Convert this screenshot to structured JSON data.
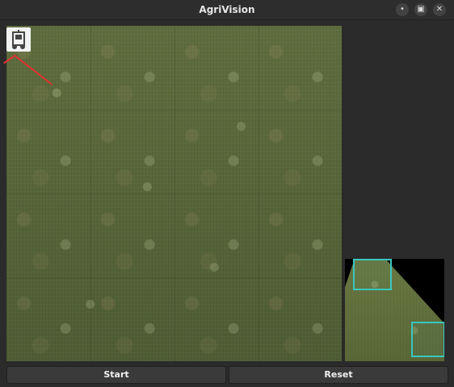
{
  "app": {
    "title": "AgriVision"
  },
  "window_controls": {
    "minimize_glyph": "•",
    "maximize_glyph": "▣",
    "close_glyph": "✕"
  },
  "buttons": {
    "start_label": "Start",
    "reset_label": "Reset"
  },
  "colors": {
    "accent_box": "#3bc6bf",
    "ray": "#e33131",
    "background": "#2b2b2b"
  }
}
